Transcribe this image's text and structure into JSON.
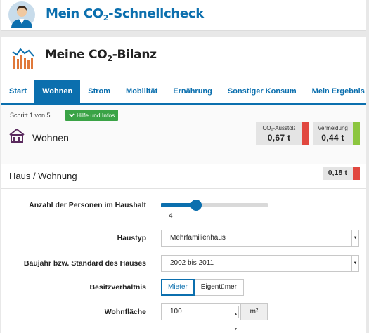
{
  "header": {
    "title_main": "Mein CO",
    "title_sub": "2",
    "title_rest": "-Schnellcheck"
  },
  "card": {
    "title_main": "Meine CO",
    "title_sub": "2",
    "title_rest": "-Bilanz"
  },
  "tabs": [
    {
      "label": "Start",
      "active": false
    },
    {
      "label": "Wohnen",
      "active": true
    },
    {
      "label": "Strom",
      "active": false
    },
    {
      "label": "Mobilität",
      "active": false
    },
    {
      "label": "Ernährung",
      "active": false
    },
    {
      "label": "Sonstiger Konsum",
      "active": false
    },
    {
      "label": "Mein Ergebnis",
      "active": false
    }
  ],
  "step": {
    "text": "Schritt 1 von 5",
    "help_label": "Hilfe und Infos"
  },
  "section": {
    "title": "Wohnen"
  },
  "stats": {
    "emission_label": "CO₂-Ausstoß",
    "emission_value": "0,67 t",
    "avoidance_label": "Vermeidung",
    "avoidance_value": "0,44 t"
  },
  "subsection": {
    "title": "Haus / Wohnung",
    "value": "0,18 t"
  },
  "form": {
    "persons": {
      "label": "Anzahl der Personen im Haushalt",
      "value": "4",
      "level": 0.33
    },
    "house_type": {
      "label": "Haustyp",
      "value": "Mehrfamilienhaus"
    },
    "build_year": {
      "label": "Baujahr bzw. Standard des Hauses",
      "value": "2002 bis 2011"
    },
    "ownership": {
      "label": "Besitzverhältnis",
      "options": [
        "Mieter",
        "Eigentümer"
      ],
      "selected": "Mieter"
    },
    "area": {
      "label": "Wohnfläche",
      "value": "100",
      "unit": "m²"
    }
  },
  "colors": {
    "brand": "#0b6fae",
    "emission": "#e1473f",
    "avoidance": "#8cc63f",
    "help": "#3aa346"
  },
  "icons": [
    "user-avatar-icon",
    "bar-chart-icon",
    "house-icon",
    "chevron-down-icon",
    "spinner-up-icon",
    "spinner-down-icon"
  ]
}
